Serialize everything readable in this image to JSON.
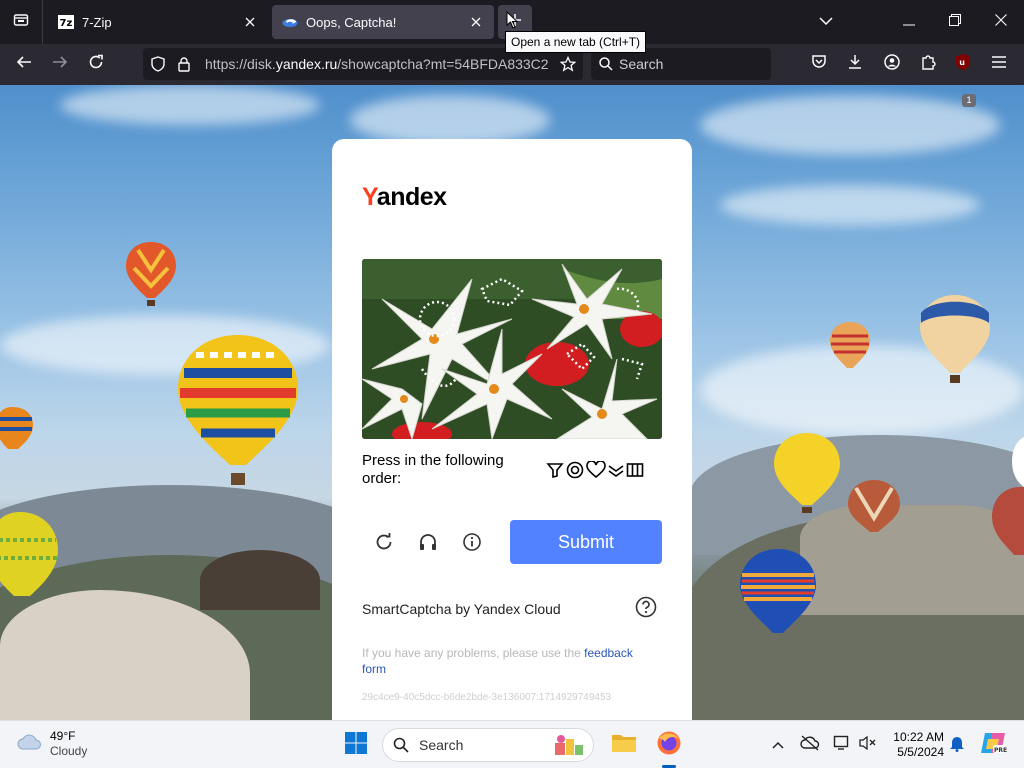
{
  "browser": {
    "tabs": [
      {
        "title": "7-Zip",
        "icon": "7zip-icon",
        "active": false
      },
      {
        "title": "Oops, Captcha!",
        "icon": "yandex-icon",
        "active": true
      }
    ],
    "new_tab_tooltip": "Open a new tab (Ctrl+T)",
    "url_prefix": "https://disk.",
    "url_host": "yandex.ru",
    "url_rest": "/showcaptcha?mt=54BFDA833C2",
    "search_placeholder": "Search",
    "extension_badge": "1"
  },
  "captcha": {
    "logo_first": "Y",
    "logo_rest": "andex",
    "instruction": "Press in the following order:",
    "order_icons": [
      "filter-icon",
      "spiral-icon",
      "heart-icon",
      "chevrons-icon",
      "columns-icon"
    ],
    "submit_label": "Submit",
    "footer_label": "SmartCaptcha by Yandex Cloud",
    "problems_text": "If you have any problems, please use the ",
    "feedback_link": "feedback form",
    "token": "29c4ce9-40c5dcc-b6de2bde-3e136007:1714929749453"
  },
  "taskbar": {
    "temperature": "49°F",
    "condition": "Cloudy",
    "search_placeholder": "Search",
    "time": "10:22 AM",
    "date": "5/5/2024"
  },
  "colors": {
    "submit": "#5282ff",
    "yandex_red": "#fc3f1d",
    "link": "#2a56b8",
    "tab_active": "#42414d",
    "toolbar": "#2b2a33"
  }
}
